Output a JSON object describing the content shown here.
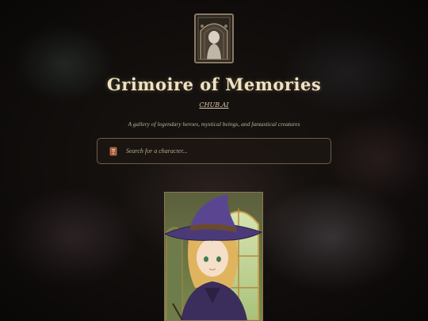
{
  "header": {
    "title": "Grimoire of Memories",
    "link_label": "CHUB.AI",
    "tagline": "A gallery of legendary heroes, mystical beings, and fantastical creatures"
  },
  "search": {
    "placeholder": "Search for a character...",
    "icon": "book-icon"
  },
  "gallery": {
    "cards": [
      {
        "icon": "character-portrait-witch"
      }
    ]
  },
  "colors": {
    "accent": "#efe2c3",
    "border": "#8a7a64",
    "background": "#15110f"
  }
}
